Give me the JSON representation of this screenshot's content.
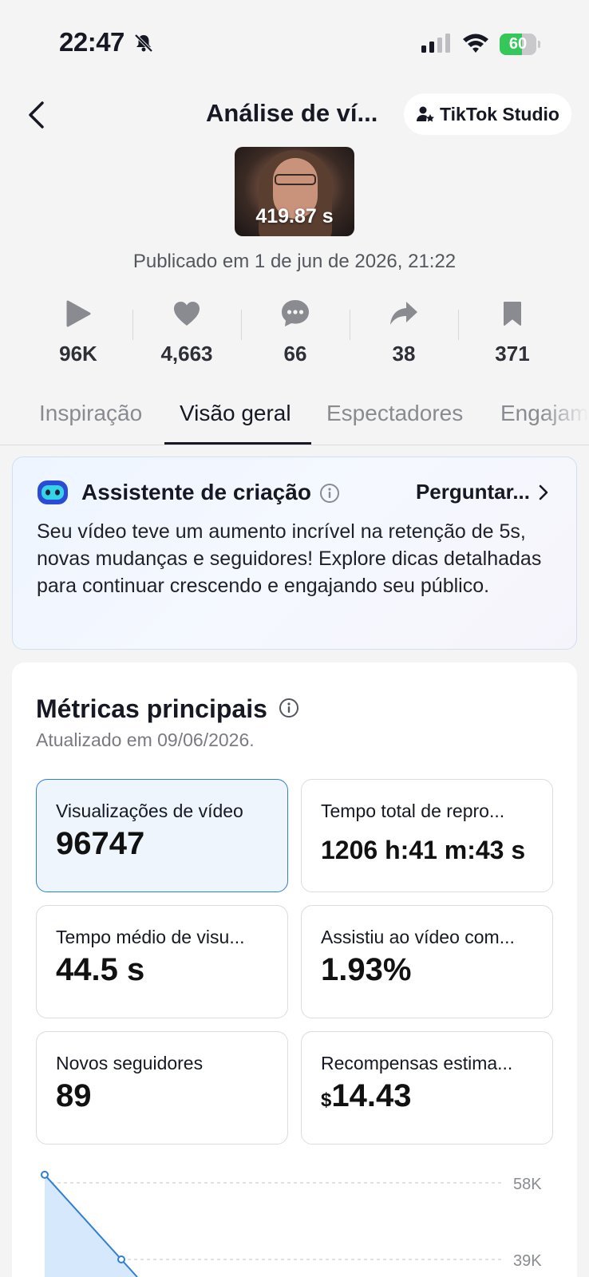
{
  "status_bar": {
    "time": "22:47",
    "battery": "60",
    "battery_level": 0.6
  },
  "header": {
    "title": "Análise de ví...",
    "studio_label": "TikTok Studio"
  },
  "video": {
    "duration": "419.87 s",
    "published": "Publicado em 1 de jun de 2026, 21:22"
  },
  "stats": [
    {
      "icon": "play-icon",
      "value": "96K"
    },
    {
      "icon": "heart-icon",
      "value": "4,663"
    },
    {
      "icon": "comment-icon",
      "value": "66"
    },
    {
      "icon": "share-icon",
      "value": "38"
    },
    {
      "icon": "bookmark-icon",
      "value": "371"
    }
  ],
  "tabs": [
    {
      "label": "Inspiração",
      "active": false
    },
    {
      "label": "Visão geral",
      "active": true
    },
    {
      "label": "Espectadores",
      "active": false
    },
    {
      "label": "Engajam",
      "active": false
    }
  ],
  "assistant": {
    "title": "Assistente de criação",
    "ask_label": "Perguntar...",
    "text": "Seu vídeo teve um aumento incrível na retenção de 5s, novas mudanças e seguidores! Explore dicas detalhadas para continuar crescendo e engajando seu público."
  },
  "metrics": {
    "title": "Métricas principais",
    "updated": "Atualizado em 09/06/2026.",
    "items": [
      {
        "label": "Visualizações de vídeo",
        "value": "96747",
        "selected": true
      },
      {
        "label": "Tempo total de repro...",
        "value": "1206 h:41 m:43 s",
        "selected": false
      },
      {
        "label": "Tempo médio de visu...",
        "value": "44.5 s",
        "selected": false
      },
      {
        "label": "Assistiu ao vídeo com...",
        "value": "1.93%",
        "selected": false
      },
      {
        "label": "Novos seguidores",
        "value": "89",
        "selected": false
      },
      {
        "label": "Recompensas estima...",
        "currency": "$",
        "value": "14.43",
        "selected": false
      }
    ]
  },
  "chart_data": {
    "type": "area",
    "tick_labels": [
      "58K",
      "39K"
    ],
    "ticks": [
      58000,
      39000
    ],
    "series": [
      {
        "values": [
          60000,
          39000
        ]
      }
    ],
    "colors": {
      "line": "#2f7fd6",
      "fill": "#d6e8fb"
    }
  }
}
